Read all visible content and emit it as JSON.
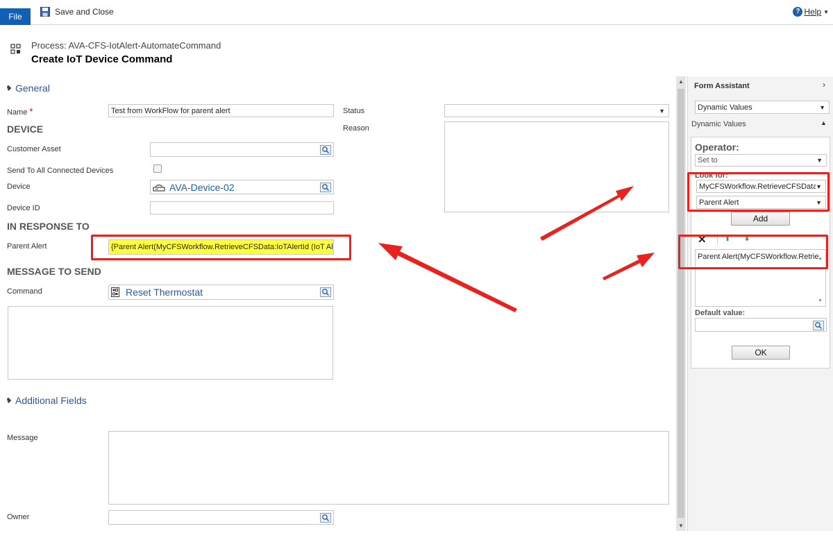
{
  "ribbon": {
    "file_label": "File",
    "save_close_label": "Save and Close",
    "help_label": "Help"
  },
  "header": {
    "process_label": "Process: AVA-CFS-IotAlert-AutomateCommand",
    "title": "Create IoT Device Command"
  },
  "general": {
    "section_label": "General",
    "name_label": "Name",
    "required_mark": "*",
    "name_value": "Test from WorkFlow for parent alert",
    "status_label": "Status",
    "status_value": "",
    "reason_label": "Reason",
    "device_group": "DEVICE",
    "customer_asset_label": "Customer Asset",
    "send_all_label": "Send To All Connected Devices",
    "device_label": "Device",
    "device_value": "AVA-Device-02",
    "device_id_label": "Device ID",
    "response_group": "IN RESPONSE TO",
    "parent_alert_label": "Parent Alert",
    "parent_alert_value": "{Parent Alert(MyCFSWorkflow.RetrieveCFSData:IoTAlertId (IoT Aler",
    "message_group": "MESSAGE TO SEND",
    "command_label": "Command",
    "command_value": "Reset Thermostat"
  },
  "additional": {
    "section_label": "Additional Fields",
    "message_label": "Message",
    "owner_label": "Owner"
  },
  "assistant": {
    "title": "Form Assistant",
    "mode_select": "Dynamic Values",
    "section_label": "Dynamic Values",
    "operator_label": "Operator:",
    "operator_value": "Set to",
    "look_for_label": "Look for:",
    "look_for_entity": "MyCFSWorkflow.RetrieveCFSData:I",
    "look_for_field": "Parent Alert",
    "add_label": "Add",
    "list_items": [
      "Parent Alert(MyCFSWorkflow.Retrie"
    ],
    "default_value_label": "Default value:",
    "ok_label": "OK"
  },
  "colors": {
    "accent": "#1160b7",
    "highlight": "#ffff3b",
    "annotation": "#e8231f"
  }
}
